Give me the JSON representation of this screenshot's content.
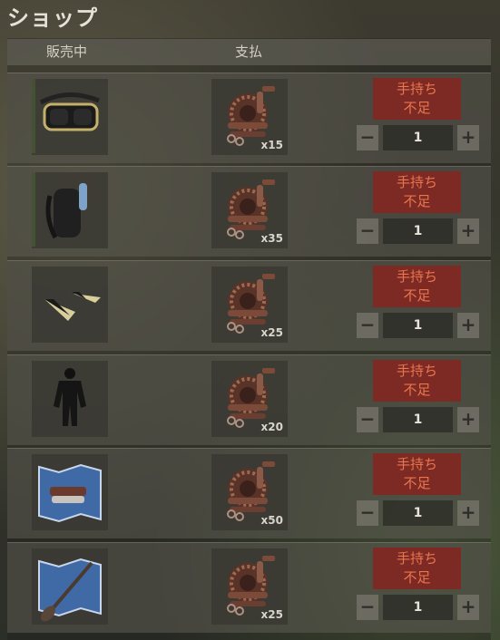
{
  "title": "ショップ",
  "columns": {
    "selling": "販売中",
    "cost": "支払"
  },
  "insufficient": [
    "手持ち",
    "不足"
  ],
  "rows": [
    {
      "item_icon": "diving-mask-icon",
      "cost_icon": "scrap-metal-icon",
      "cost": "x15",
      "quantity": "1",
      "selected": true
    },
    {
      "item_icon": "diving-tank-icon",
      "cost_icon": "scrap-metal-icon",
      "cost": "x35",
      "quantity": "1",
      "selected": true
    },
    {
      "item_icon": "diving-fins-icon",
      "cost_icon": "scrap-metal-icon",
      "cost": "x25",
      "quantity": "1",
      "selected": false
    },
    {
      "item_icon": "wetsuit-icon",
      "cost_icon": "scrap-metal-icon",
      "cost": "x20",
      "quantity": "1",
      "selected": false
    },
    {
      "item_icon": "blueprint-boat-icon",
      "cost_icon": "scrap-metal-icon",
      "cost": "x50",
      "quantity": "1",
      "selected": false
    },
    {
      "item_icon": "blueprint-paddle-icon",
      "cost_icon": "scrap-metal-icon",
      "cost": "x25",
      "quantity": "1",
      "selected": false
    }
  ],
  "buttons": {
    "minus": "−",
    "plus": "+"
  },
  "colors": {
    "insufficient_bg": "#7c2a23",
    "insufficient_text": "#e8764f",
    "selected_marker": "#6ea33a"
  }
}
